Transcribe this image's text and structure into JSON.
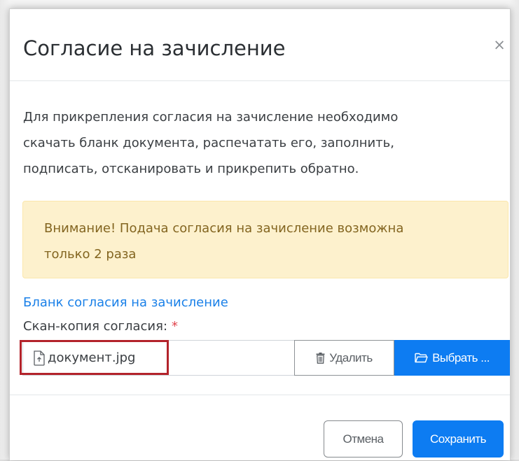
{
  "modal": {
    "title": "Согласие на зачисление",
    "close_symbol": "×"
  },
  "body": {
    "intro_lines": [
      "Для прикрепления согласия на зачисление необходимо",
      "скачать бланк документа, распечатать его, заполнить,",
      "подписать, отсканировать и прикрепить обратно."
    ],
    "alert_lines": [
      "Внимание! Подача согласия на зачисление возможна",
      "только 2 раза"
    ],
    "blank_link": "Бланк согласия на зачисление",
    "field_label": "Скан-копия согласия:",
    "required_mark": "*",
    "file_name": "документ.jpg",
    "delete_label": "Удалить",
    "choose_label": "Выбрать ..."
  },
  "footer": {
    "cancel_label": "Отмена",
    "save_label": "Сохранить"
  },
  "icons": {
    "close": "close-icon",
    "file": "file-upload-icon",
    "trash": "trash-icon",
    "folder": "folder-open-icon"
  },
  "colors": {
    "primary": "#0d7cf2",
    "alert_bg": "#fdf1cd",
    "alert_text": "#836520",
    "link": "#1a80e8",
    "required": "#e0434c",
    "highlight": "#b3232b"
  }
}
